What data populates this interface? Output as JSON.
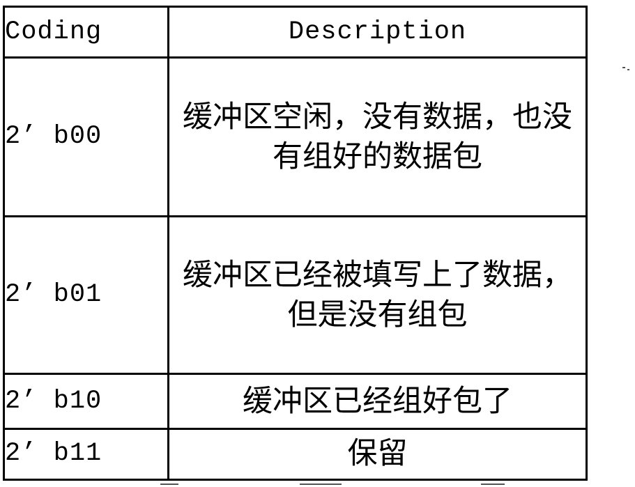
{
  "document": {
    "type": "scanned-table",
    "ink_color": "#000000",
    "background_color": "#ffffff"
  },
  "table": {
    "columns": [
      {
        "key": "coding",
        "header": "Coding"
      },
      {
        "key": "description",
        "header": "Description"
      }
    ],
    "rows": [
      {
        "coding": "2’ b00",
        "description": "缓冲区空闲，没有数据，也没有组好的数据包"
      },
      {
        "coding": "2’ b01",
        "description": "缓冲区已经被填写上了数据，但是没有组包"
      },
      {
        "coding": "2’ b10",
        "description": "缓冲区已经组好包了"
      },
      {
        "coding": "2’ b11",
        "description": "保留"
      }
    ]
  }
}
